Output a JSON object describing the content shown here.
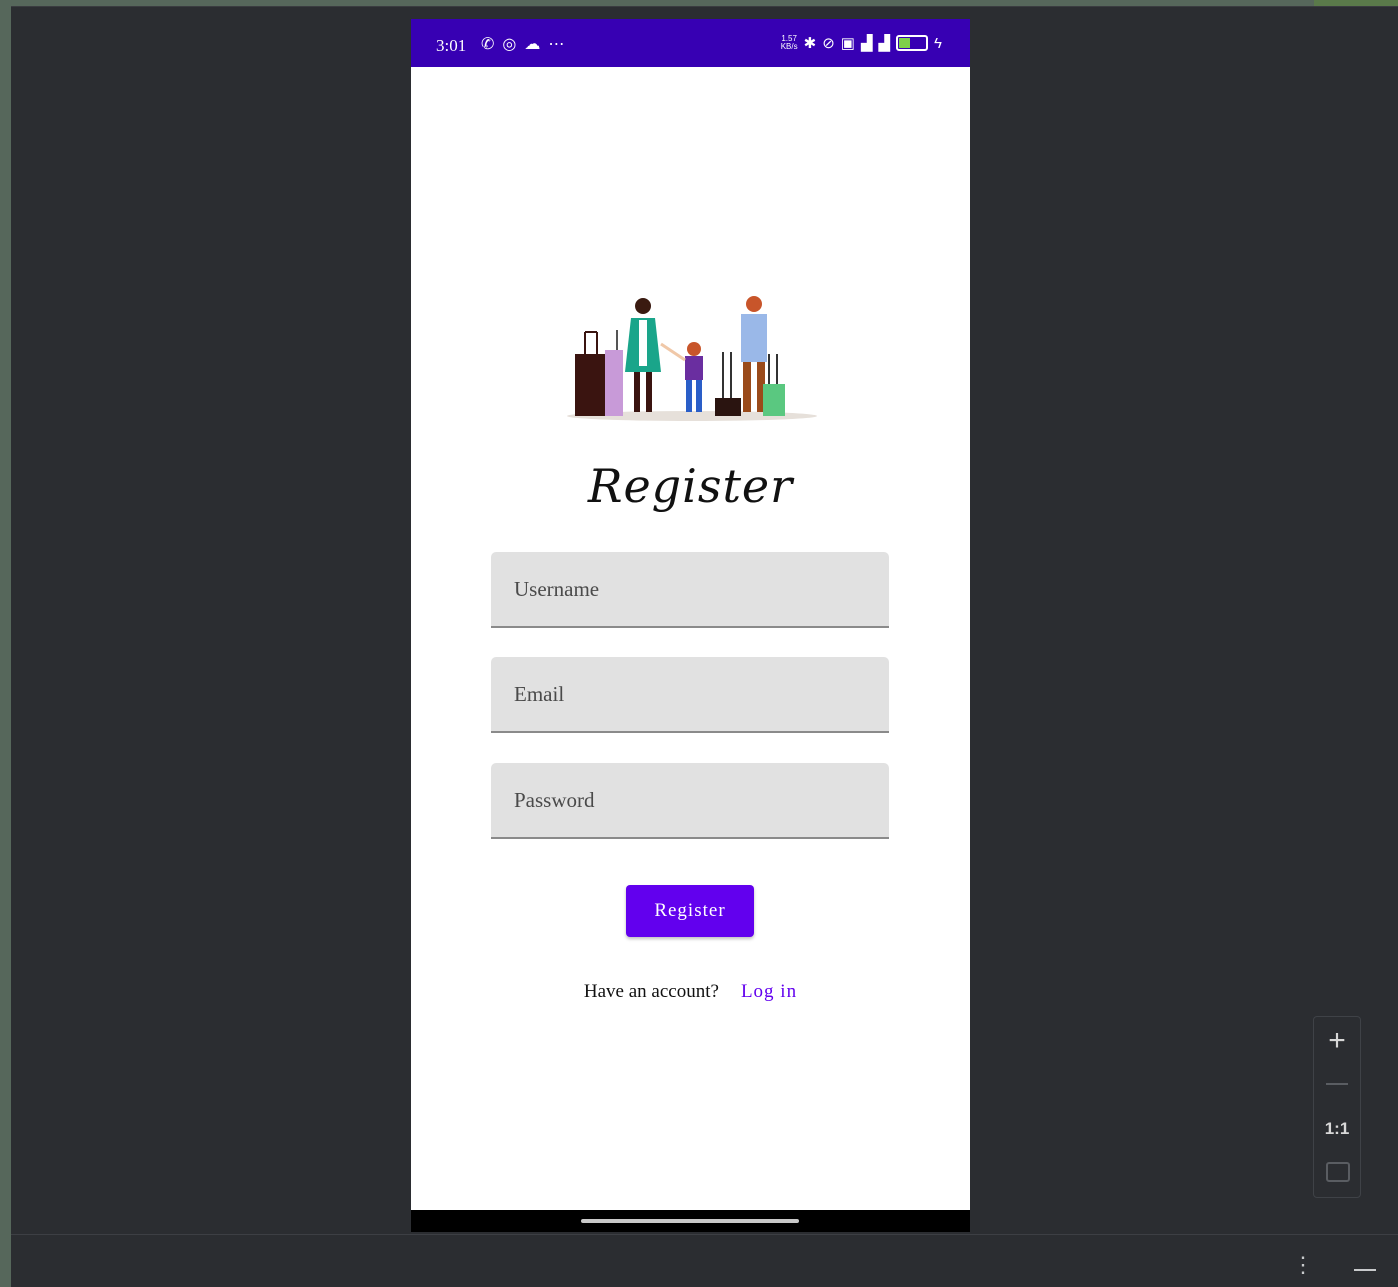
{
  "status_bar": {
    "time": "3:01",
    "left_icons": [
      "whatsapp-icon",
      "chrome-icon",
      "cloud-icon",
      "more-icon"
    ],
    "right_icons": [
      "network-speed-icon",
      "bluetooth-icon",
      "alarm-off-icon",
      "nfc-icon",
      "5g-signal-icon",
      "signal-icon",
      "battery-icon",
      "charging-icon"
    ],
    "network_speed": "1.57 KB/s",
    "battery_level": "50",
    "color": "#3700b3"
  },
  "register_screen": {
    "title": "Register",
    "fields": {
      "username_placeholder": "Username",
      "email_placeholder": "Email",
      "password_placeholder": "Password"
    },
    "register_button": "Register",
    "have_account_text": "Have an account?",
    "login_link": "Log in",
    "accent_color": "#6200ee"
  },
  "emulator_controls": {
    "zoom_in": "+",
    "zoom_ratio": "1:1"
  }
}
